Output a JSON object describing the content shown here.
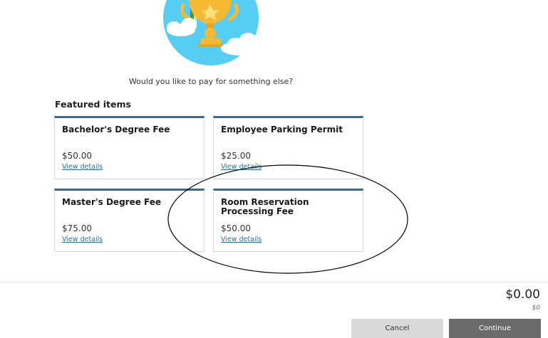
{
  "prompt": "Would you like to pay for something else?",
  "featured": {
    "title": "Featured items",
    "items": [
      {
        "name": "Bachelor's Degree Fee",
        "price": "$50.00",
        "link": "View details"
      },
      {
        "name": "Employee Parking Permit",
        "price": "$25.00",
        "link": "View details"
      },
      {
        "name": "Master's Degree Fee",
        "price": "$75.00",
        "link": "View details"
      },
      {
        "name": "Room Reservation Processing Fee",
        "price": "$50.00",
        "link": "View details"
      }
    ]
  },
  "summary": {
    "total": "$0.00",
    "subtotal": "$0"
  },
  "actions": {
    "cancel_label": "Cancel",
    "continue_label": "Continue"
  },
  "colors": {
    "accent": "#2f6e95",
    "illustration_sky": "#56cdf3",
    "trophy": "#f5b933"
  }
}
